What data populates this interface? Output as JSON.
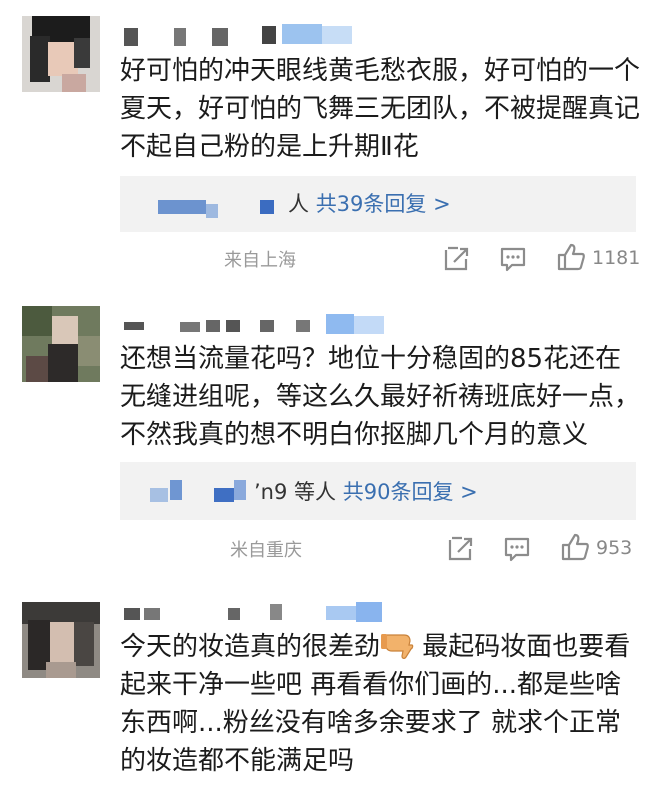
{
  "colors": {
    "accent_link": "#3a6fb0",
    "reply_bg": "#f2f2f2",
    "meta_text": "#9a9a9a",
    "icon_gray": "#8c8c8c"
  },
  "comments": [
    {
      "text": "好可怕的冲天眼线黄毛愁衣服，好可怕的一个夏天，好可怕的飞舞三无团队，不被提醒真记不起自己粉的是上升期Ⅱ花",
      "reply": {
        "people": "人",
        "count_text": "共39条回复 >"
      },
      "location": "来自上海",
      "likes": "1181",
      "icons": [
        "share-icon",
        "comment-icon",
        "like-icon"
      ]
    },
    {
      "text": "还想当流量花吗？地位十分稳固的85花还在无缝进组呢，等这么久最好祈祷班底好一点，不然我真的想不明白你抠脚几个月的意义",
      "reply": {
        "people": "’n9 等人",
        "count_text": "共90条回复 >"
      },
      "location": "米自重庆",
      "likes": "953",
      "icons": [
        "share-icon",
        "comment-icon",
        "like-icon"
      ]
    },
    {
      "text_before_emoji": "今天的妆造真的很差劲",
      "emoji": "thumbs-down-icon",
      "text_after_emoji": " 最起码妆面也要看起来干净一些吧 再看看你们画的...都是些啥东西啊...粉丝没有啥多余要求了 就求个正常的妆造都不能满足吗"
    }
  ]
}
